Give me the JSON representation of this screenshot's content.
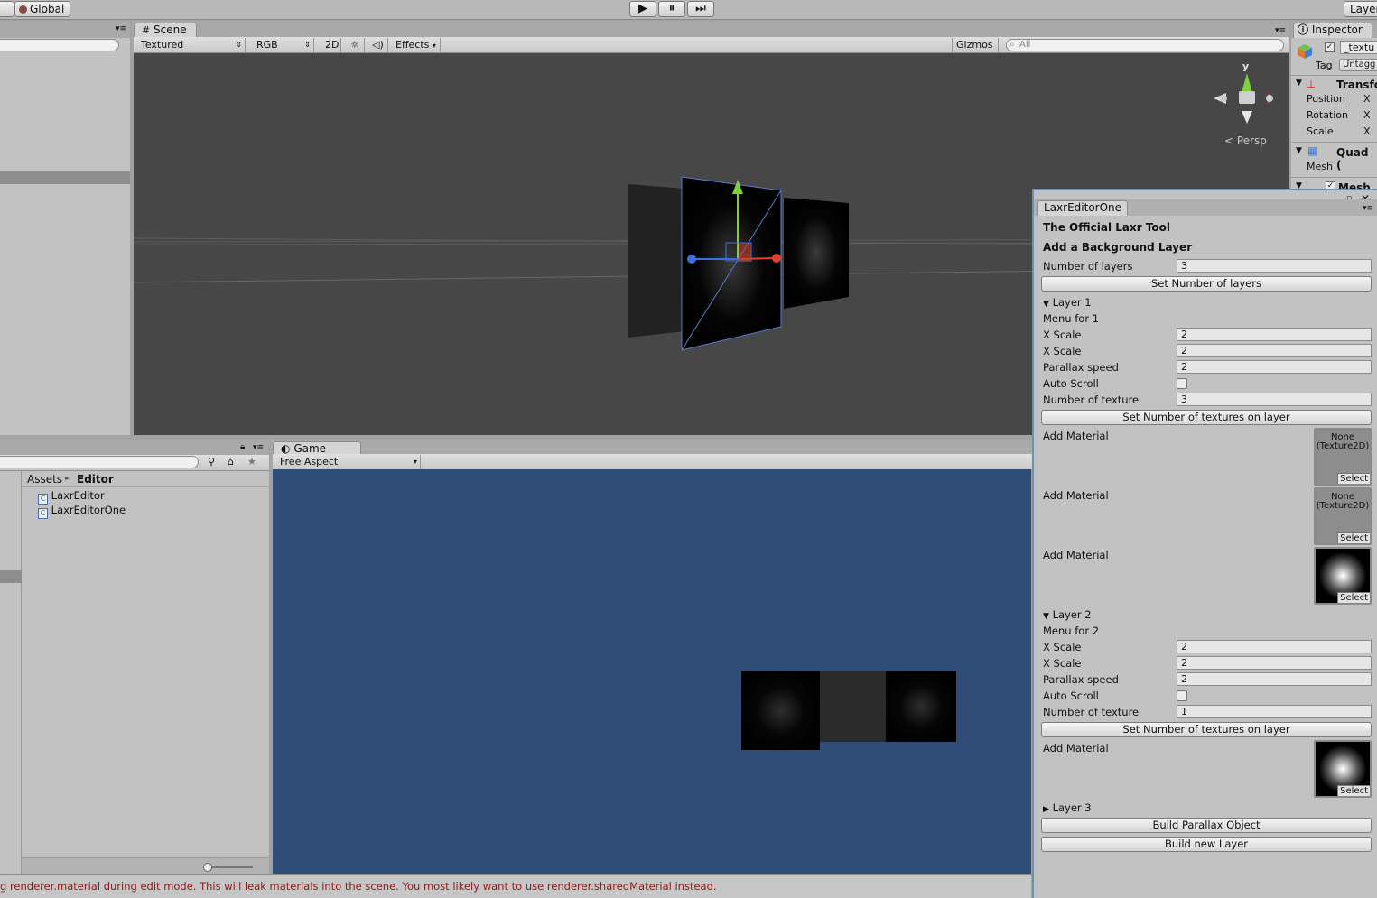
{
  "toolbar": {
    "global_label": "Global",
    "layers_label": "Layer",
    "play_icon": "▶",
    "pause_icon": "⏸",
    "step_icon": "⏭"
  },
  "scene": {
    "tab_label": "Scene",
    "render_mode": "Textured",
    "color_mode": "RGB",
    "two_d": "2D",
    "effects": "Effects",
    "gizmos": "Gizmos",
    "search_placeholder": "All",
    "persp_label": "Persp",
    "gizmo_y": "y"
  },
  "inspector": {
    "tab_label": "Inspector",
    "object_name": "_textu",
    "tag_label": "Tag",
    "tag_value": "Untagg",
    "transform_title": "Transfo",
    "position_label": "Position",
    "rotation_label": "Rotation",
    "scale_label": "Scale",
    "axis_x": "X",
    "quad_title": "Quad (",
    "mesh_label": "Mesh",
    "mesh_c_title": "Mesh C"
  },
  "laxr": {
    "tab_label": "LaxrEditorOne",
    "title": "The Official Laxr Tool",
    "subtitle": "Add a Background Layer",
    "num_layers_label": "Number of layers",
    "num_layers_value": "3",
    "set_layers_button": "Set Number of layers",
    "layer1": {
      "header": "Layer 1",
      "menu_label": "Menu for 1",
      "xscale_label": "X Scale",
      "xscale_value": "2",
      "xscale2_label": "X Scale",
      "xscale2_value": "2",
      "parallax_label": "Parallax speed",
      "parallax_value": "2",
      "auto_scroll_label": "Auto Scroll",
      "num_tex_label": "Number of texture",
      "num_tex_value": "3",
      "set_tex_button": "Set Number of textures on layer",
      "materials": [
        {
          "label": "Add Material",
          "slot_text": "None (Texture2D)",
          "select": "Select"
        },
        {
          "label": "Add Material",
          "slot_text": "None (Texture2D)",
          "select": "Select"
        },
        {
          "label": "Add Material",
          "slot_text": "",
          "select": "Select"
        }
      ]
    },
    "layer2": {
      "header": "Layer 2",
      "menu_label": "Menu for 2",
      "xscale_label": "X Scale",
      "xscale_value": "2",
      "xscale2_label": "X Scale",
      "xscale2_value": "2",
      "parallax_label": "Parallax speed",
      "parallax_value": "2",
      "auto_scroll_label": "Auto Scroll",
      "num_tex_label": "Number of texture",
      "num_tex_value": "1",
      "set_tex_button": "Set Number of textures on layer",
      "materials": [
        {
          "label": "Add Material",
          "slot_text": "",
          "select": "Select"
        }
      ]
    },
    "layer3_header": "Layer 3",
    "build_parallax_button": "Build Parallax Object",
    "build_layer_button": "Build new Layer"
  },
  "game": {
    "tab_label": "Game",
    "aspect": "Free Aspect"
  },
  "project": {
    "breadcrumb_root": "Assets",
    "breadcrumb_sep": "►",
    "breadcrumb_current": "Editor",
    "files": [
      "LaxrEditor",
      "LaxrEditorOne"
    ]
  },
  "status": {
    "message": "g renderer.material during edit mode. This will leak materials into the scene. You most likely want to use renderer.sharedMaterial instead."
  },
  "colors": {
    "scene_bg": "#474747",
    "game_bg": "#2f4c77",
    "panel_bg": "#c2c2c2",
    "status_text": "#8b1a1a",
    "gizmo_y": "#7ad33a",
    "gizmo_x": "#e0402a",
    "gizmo_z": "#3a6fe0"
  }
}
